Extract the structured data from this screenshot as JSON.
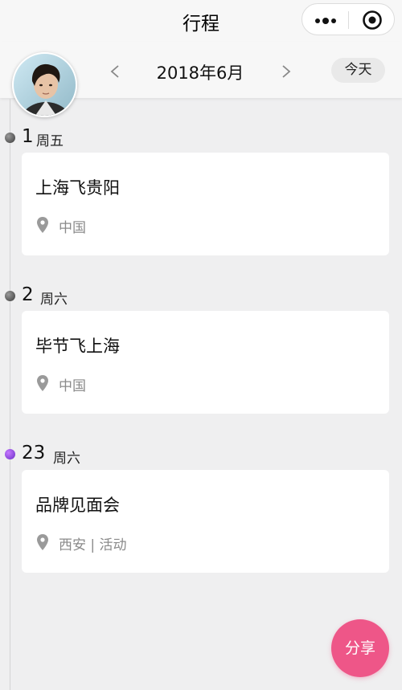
{
  "navbar": {
    "title": "行程"
  },
  "header": {
    "month": "2018年6月",
    "today_label": "今天"
  },
  "days": [
    {
      "day": "1",
      "weekday": "周五",
      "title": "上海飞贵阳",
      "location": "中国"
    },
    {
      "day": "2",
      "weekday": "周六",
      "title": "毕节飞上海",
      "location": "中国"
    },
    {
      "day": "23",
      "weekday": "周六",
      "title": "品牌见面会",
      "location": "西安 | 活动"
    }
  ],
  "share_label": "分享",
  "colors": {
    "accent": "#ee5688",
    "dot_active": "#8a3df0",
    "dot_default": "#555555"
  },
  "icons": [
    "more-icon",
    "target-icon",
    "chevron-left-icon",
    "chevron-right-icon",
    "location-pin-icon"
  ]
}
